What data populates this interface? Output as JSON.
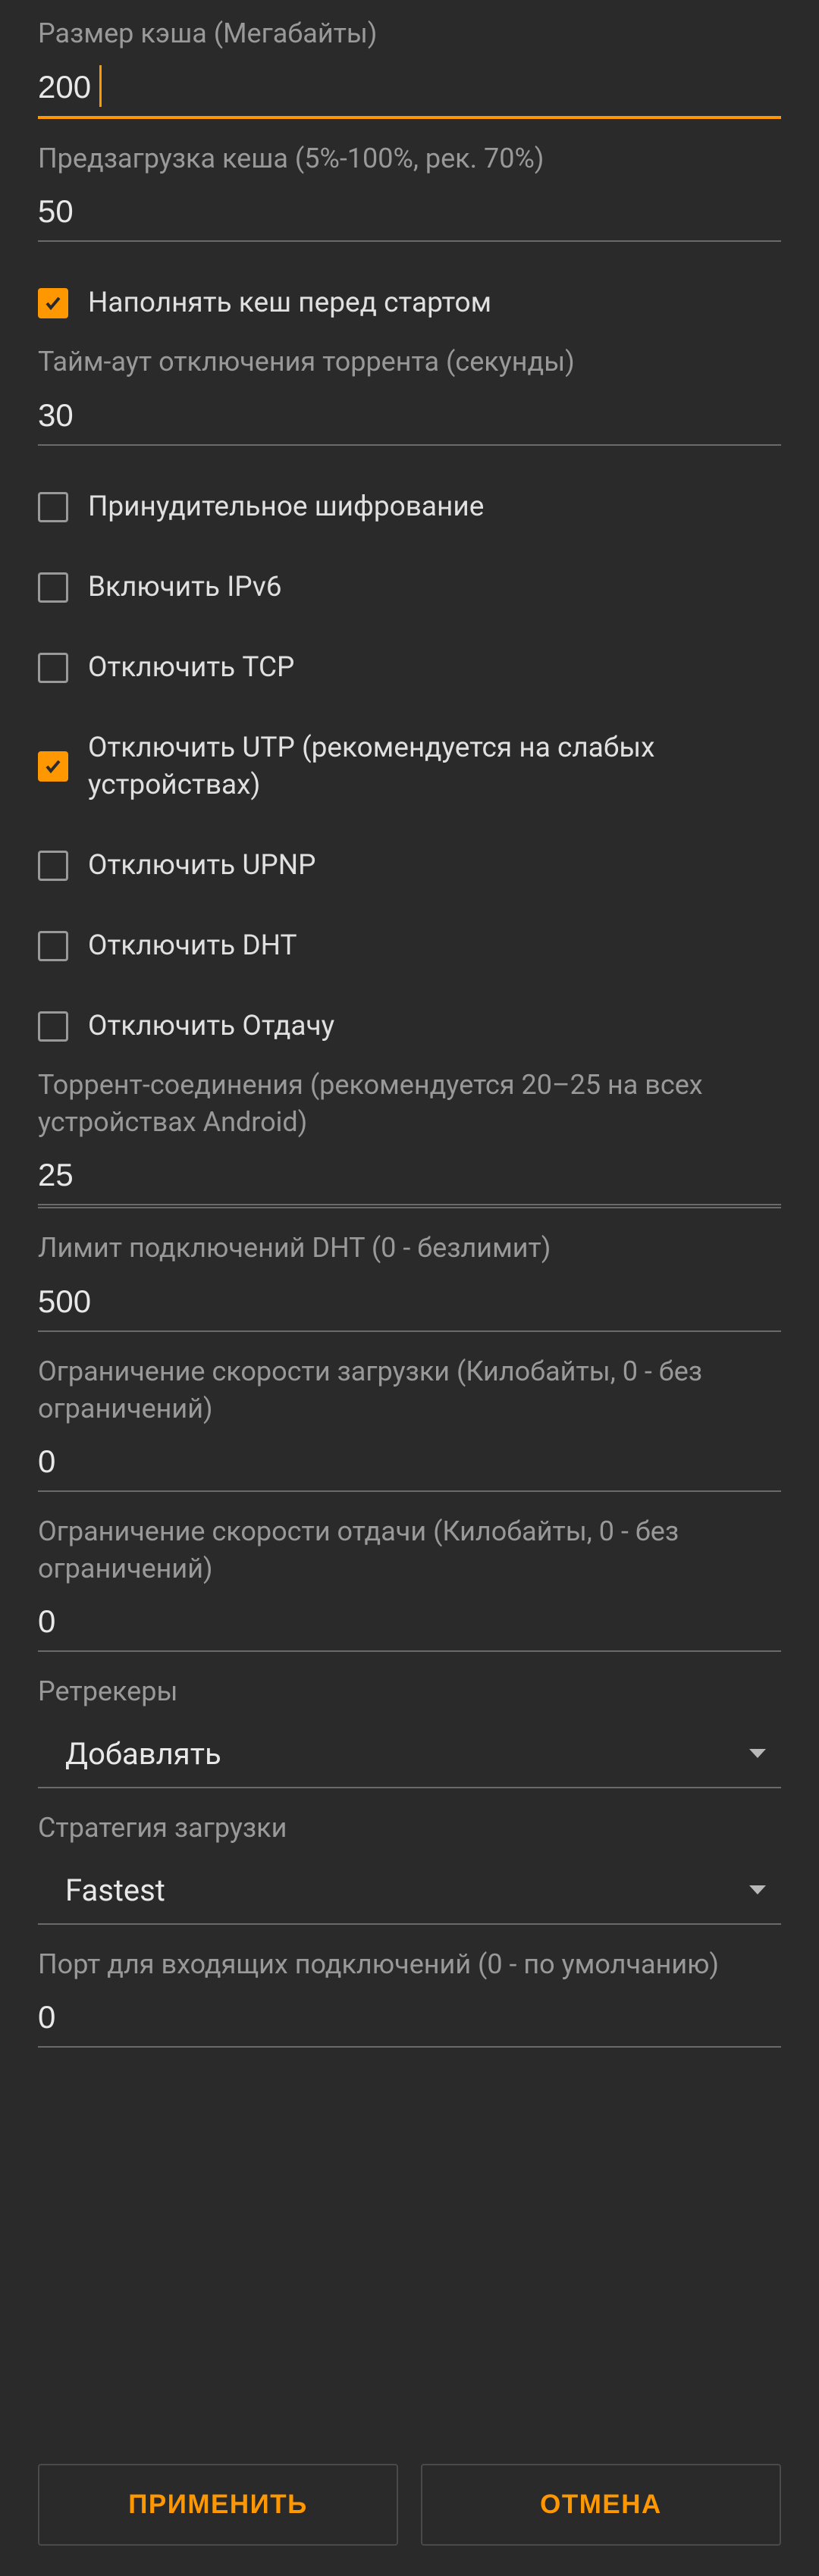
{
  "fields": {
    "cache_size": {
      "label": "Размер кэша (Мегабайты)",
      "value": "200"
    },
    "preload_cache": {
      "label": "Предзагрузка кеша (5%-100%, рек. 70%)",
      "value": "50"
    },
    "fill_before_start": {
      "label": "Наполнять кеш перед стартом"
    },
    "torrent_timeout": {
      "label": "Тайм-аут отключения торрента (секунды)",
      "value": "30"
    },
    "force_encrypt": {
      "label": "Принудительное шифрование"
    },
    "enable_ipv6": {
      "label": "Включить IPv6"
    },
    "disable_tcp": {
      "label": "Отключить TCP"
    },
    "disable_utp": {
      "label": "Отключить UTP (рекомендуется на слабых устройствах)"
    },
    "disable_upnp": {
      "label": "Отключить UPNP"
    },
    "disable_dht": {
      "label": "Отключить DHT"
    },
    "disable_upload": {
      "label": "Отключить Отдачу"
    },
    "torrent_connections": {
      "label": "Торрент-соединения (рекомендуется 20–25 на всех устройствах Android)",
      "value": "25"
    },
    "dht_limit": {
      "label": "Лимит подключений DHT (0 - безлимит)",
      "value": "500"
    },
    "download_speed": {
      "label": "Ограничение скорости загрузки (Килобайты, 0 - без ограничений)",
      "value": "0"
    },
    "upload_speed": {
      "label": "Ограничение скорости отдачи (Килобайты, 0 - без ограничений)",
      "value": "0"
    },
    "retrackers": {
      "label": "Ретрекеры",
      "value": "Добавлять"
    },
    "download_strategy": {
      "label": "Стратегия загрузки",
      "value": "Fastest"
    },
    "incoming_port": {
      "label": "Порт для входящих подключений (0 - по умолчанию)",
      "value": "0"
    }
  },
  "buttons": {
    "apply": "ПРИМЕНИТЬ",
    "cancel": "ОТМЕНА"
  }
}
